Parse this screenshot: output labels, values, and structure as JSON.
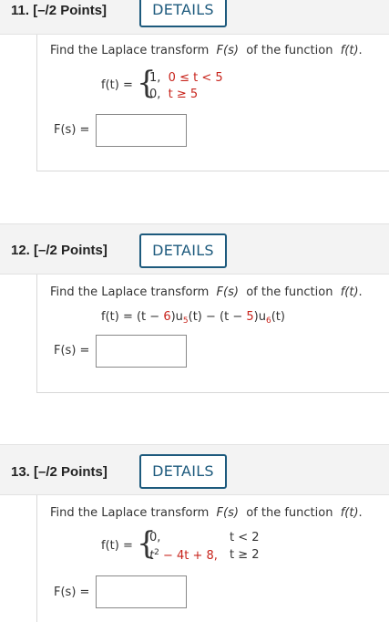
{
  "questions": [
    {
      "number": "11.",
      "points": "[–/2 Points]",
      "details_label": "DETAILS",
      "prompt_prefix": "Find the Laplace transform",
      "Fs": "F(s)",
      "prompt_middle": "of the function",
      "ft": "f(t)",
      "prompt_suffix": ".",
      "func_label": "f(t) =",
      "cases": [
        {
          "value": "1,",
          "condition": "0 ≤ t < 5"
        },
        {
          "value": "0,",
          "condition": "t ≥ 5"
        }
      ],
      "answer_label": "F(s) =",
      "answer_value": ""
    },
    {
      "number": "12.",
      "points": "[–/2 Points]",
      "details_label": "DETAILS",
      "prompt_prefix": "Find the Laplace transform",
      "Fs": "F(s)",
      "prompt_middle": "of the function",
      "ft": "f(t)",
      "prompt_suffix": ".",
      "expr": {
        "lhs": "f(t) = (t −",
        "c1": "6",
        "u1": ")u",
        "u1_sub": "5",
        "mid": "(t) − (t −",
        "c2": "5",
        "u2": ")u",
        "u2_sub": "6",
        "end": "(t)"
      },
      "answer_label": "F(s) =",
      "answer_value": ""
    },
    {
      "number": "13.",
      "points": "[–/2 Points]",
      "details_label": "DETAILS",
      "prompt_prefix": "Find the Laplace transform",
      "Fs": "F(s)",
      "prompt_middle": "of the function",
      "ft": "f(t)",
      "prompt_suffix": ".",
      "func_label": "f(t) =",
      "cases": [
        {
          "value": "0,",
          "condition": "t < 2"
        },
        {
          "value_t": "t",
          "value_exp": "2",
          "value_rest": " − 4t + 8,",
          "condition": "t ≥ 2"
        }
      ],
      "answer_label": "F(s) =",
      "answer_value": ""
    }
  ],
  "colors": {
    "accent": "#1d5a7d",
    "highlight_red": "#c8241c",
    "header_bg": "#f3f3f3"
  }
}
